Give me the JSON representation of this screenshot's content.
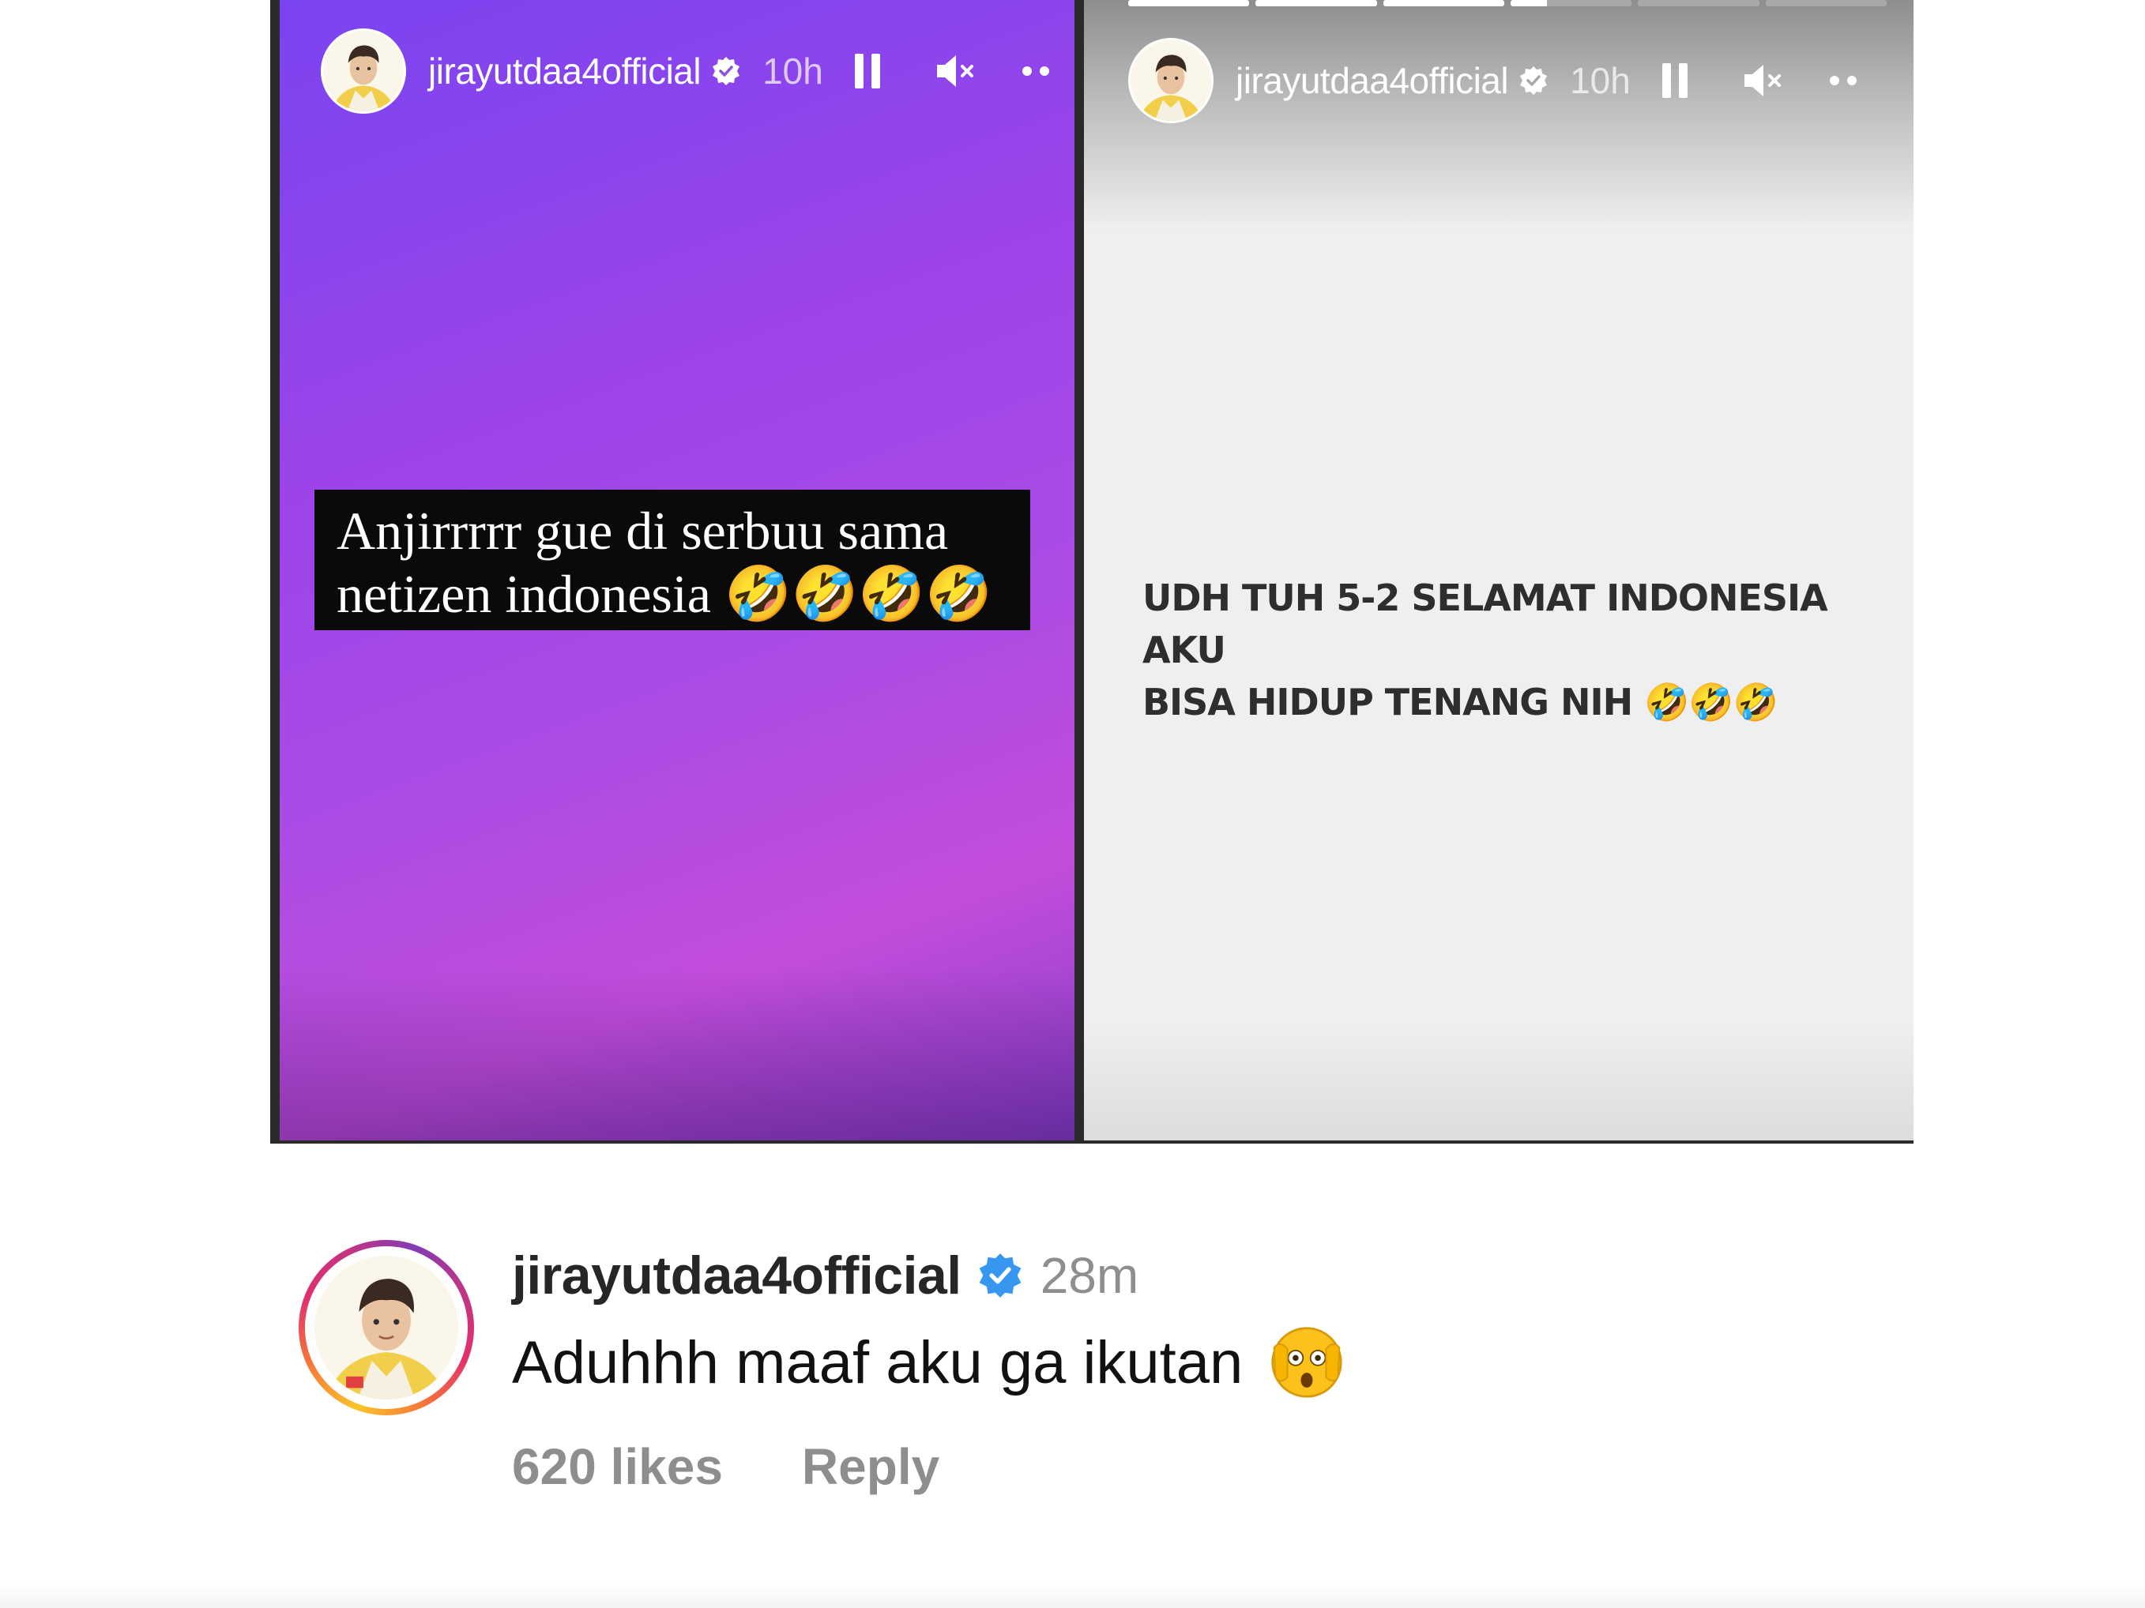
{
  "stories": {
    "left": {
      "username": "jirayutdaa4official",
      "time": "10h",
      "caption_line1": "Anjirrrrr gue di serbuu sama",
      "caption_line2": "netizen indonesia",
      "caption_emojis": "🤣🤣🤣🤣",
      "icons": [
        "avatar",
        "verified-badge-icon",
        "pause-icon",
        "mute-icon",
        "more-icon"
      ]
    },
    "right": {
      "username": "jirayutdaa4official",
      "time": "10h",
      "caption_line1": "UDH TUH 5-2 SELAMAT INDONESIA AKU",
      "caption_line2": "BISA HIDUP TENANG NIH",
      "caption_emojis": "🤣🤣🤣",
      "progress_segments": 6,
      "progress_fill": [
        1,
        1,
        1,
        0.3,
        0,
        0
      ],
      "icons": [
        "avatar",
        "verified-badge-icon",
        "pause-icon",
        "mute-icon",
        "more-icon"
      ]
    }
  },
  "comment": {
    "username": "jirayutdaa4official",
    "time": "28m",
    "text": "Aduhhh maaf aku ga ikutan",
    "emoji_icon": "peeking-face-emoji",
    "likes": "620 likes",
    "reply": "Reply"
  },
  "colors": {
    "verified_blue": "#3797f0",
    "muted_text": "#8e8e8e",
    "story_purple": "#9c44ea",
    "story_gray": "#efefef"
  }
}
